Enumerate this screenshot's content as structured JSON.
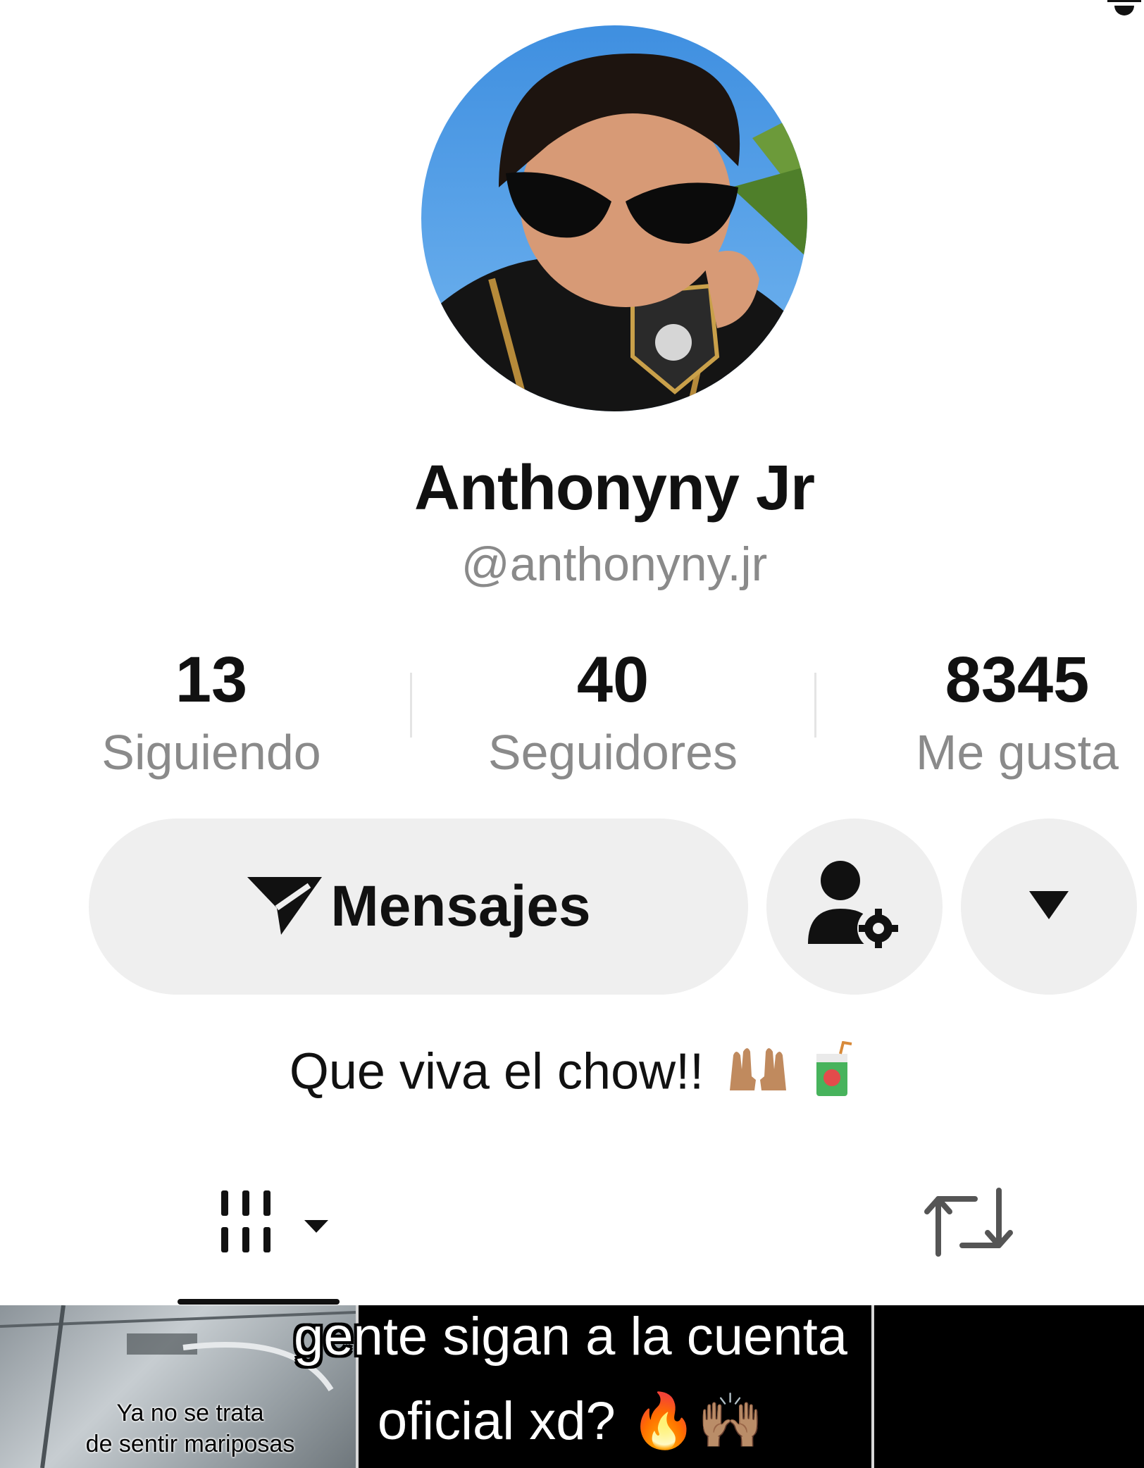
{
  "profile": {
    "display_name": "Anthonyny Jr",
    "username": "@anthonyny.jr",
    "bio": "Que viva el chow!!",
    "bio_emoji_icons": [
      "raising-hands-icon",
      "juice-box-icon"
    ]
  },
  "stats": [
    {
      "value": "13",
      "label": "Siguiendo"
    },
    {
      "value": "40",
      "label": "Seguidores"
    },
    {
      "value": "8345",
      "label": "Me gusta"
    }
  ],
  "actions": {
    "messages_label": "Mensajes",
    "messages_icon": "send-icon",
    "settings_icon": "person-gear-icon",
    "more_icon": "caret-down-icon"
  },
  "tabs": {
    "videos_icon": "grid-icon",
    "reposts_icon": "repost-icon"
  },
  "video_strip": {
    "thumb_caption_line1": "Ya no se trata",
    "thumb_caption_line2": "de sentir mariposas",
    "overlay_line1": "gente sigan a la cuenta",
    "overlay_line2": "oficial xd? 🔥🙌🏽"
  },
  "colors": {
    "primary_text": "#111111",
    "secondary_text": "#8a8a8a",
    "button_bg": "#efefef",
    "strip_bg": "#000000"
  }
}
